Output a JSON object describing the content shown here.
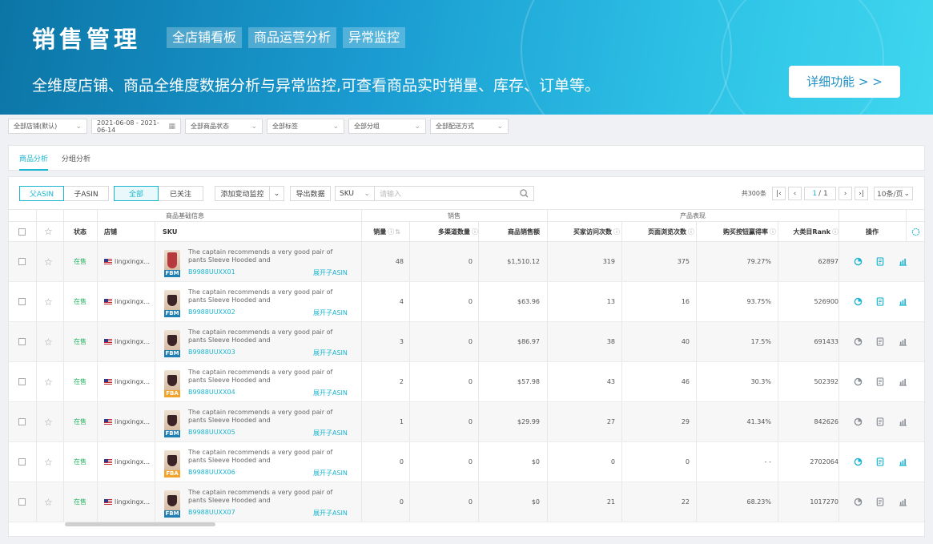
{
  "banner": {
    "title": "销售管理",
    "tags": [
      "全店铺看板",
      "商品运营分析",
      "异常监控"
    ],
    "subtitle": "全维度店铺、商品全维度数据分析与异常监控,可查看商品实时销量、库存、订单等。",
    "detail_button": "详细功能 > >"
  },
  "filters": [
    {
      "label": "全部店铺(默认)",
      "icon": "chevron-down-icon"
    },
    {
      "label": "2021-06-08 - 2021-06-14",
      "icon": "calendar-icon"
    },
    {
      "label": "全部商品状态",
      "icon": "chevron-down-icon"
    },
    {
      "label": "全部标签",
      "icon": "chevron-down-icon"
    },
    {
      "label": "全部分组",
      "icon": "chevron-down-icon"
    },
    {
      "label": "全部配送方式",
      "icon": "chevron-down-icon"
    }
  ],
  "tabs": [
    "商品分析",
    "分组分析"
  ],
  "toolbar": {
    "parent_asin": "父ASIN",
    "child_asin": "子ASIN",
    "all": "全部",
    "followed": "已关注",
    "add_monitor": "添加变动监控",
    "export": "导出数据",
    "search_field": "SKU",
    "search_placeholder": "请输入"
  },
  "pagination": {
    "total": "共300条",
    "page": "1",
    "pages": "/ 1",
    "per_page": "10条/页"
  },
  "groups": {
    "base": "商品基础信息",
    "sales": "销售",
    "perf": "产品表现"
  },
  "columns": {
    "status": "状态",
    "shop": "店铺",
    "sku": "SKU",
    "qty": "销量",
    "multi": "多渠道数量",
    "amount": "商品销售额",
    "visits": "买家访问次数",
    "views": "页面浏览次数",
    "buybox": "购买按钮赢得率",
    "rank": "大类目Rank",
    "ops": "操作"
  },
  "colors": {
    "accent": "#1ab5d0",
    "status_green": "#21b35f",
    "fbm": "#1f7fb2",
    "fba": "#f2a32b"
  },
  "rows": [
    {
      "status": "在售",
      "shop": "lingxingx...",
      "desc": "The captain recommends a very good pair of pants Sleeve Hooded and",
      "sku": "B9988UUXX01",
      "expand": "展开子ASIN",
      "fulfill": "FBM",
      "img": "red",
      "qty": "48",
      "multi": "0",
      "amount": "$1,510.12",
      "visits": "319",
      "views": "375",
      "buybox": "79.27%",
      "rank": "62897",
      "active_ops": true
    },
    {
      "status": "在售",
      "shop": "lingxingx...",
      "desc": "The captain recommends a very good pair of pants Sleeve Hooded and",
      "sku": "B9988UUXX02",
      "expand": "展开子ASIN",
      "fulfill": "FBM",
      "img": "dark",
      "qty": "4",
      "multi": "0",
      "amount": "$63.96",
      "visits": "13",
      "views": "16",
      "buybox": "93.75%",
      "rank": "526900",
      "active_ops": true
    },
    {
      "status": "在售",
      "shop": "lingxingx...",
      "desc": "The captain recommends a very good pair of pants Sleeve Hooded and",
      "sku": "B9988UUXX03",
      "expand": "展开子ASIN",
      "fulfill": "FBM",
      "img": "dark",
      "qty": "3",
      "multi": "0",
      "amount": "$86.97",
      "visits": "38",
      "views": "40",
      "buybox": "17.5%",
      "rank": "691433",
      "active_ops": false
    },
    {
      "status": "在售",
      "shop": "lingxingx...",
      "desc": "The captain recommends a very good pair of pants Sleeve Hooded and",
      "sku": "B9988UUXX04",
      "expand": "展开子ASIN",
      "fulfill": "FBA",
      "img": "dark",
      "qty": "2",
      "multi": "0",
      "amount": "$57.98",
      "visits": "43",
      "views": "46",
      "buybox": "30.3%",
      "rank": "502392",
      "active_ops": false
    },
    {
      "status": "在售",
      "shop": "lingxingx...",
      "desc": "The captain recommends a very good pair of pants Sleeve Hooded and",
      "sku": "B9988UUXX05",
      "expand": "展开子ASIN",
      "fulfill": "FBM",
      "img": "dark",
      "qty": "1",
      "multi": "0",
      "amount": "$29.99",
      "visits": "27",
      "views": "29",
      "buybox": "41.34%",
      "rank": "842626",
      "active_ops": false
    },
    {
      "status": "在售",
      "shop": "lingxingx...",
      "desc": "The captain recommends a very good pair of pants Sleeve Hooded and",
      "sku": "B9988UUXX06",
      "expand": "展开子ASIN",
      "fulfill": "FBA",
      "img": "dark",
      "qty": "0",
      "multi": "0",
      "amount": "$0",
      "visits": "0",
      "views": "0",
      "buybox": "- -",
      "rank": "2702064",
      "active_ops": true
    },
    {
      "status": "在售",
      "shop": "lingxingx...",
      "desc": "The captain recommends a very good pair of pants Sleeve Hooded and",
      "sku": "B9988UUXX07",
      "expand": "展开子ASIN",
      "fulfill": "FBM",
      "img": "dark",
      "qty": "0",
      "multi": "0",
      "amount": "$0",
      "visits": "21",
      "views": "22",
      "buybox": "68.23%",
      "rank": "1017270",
      "active_ops": false
    }
  ]
}
